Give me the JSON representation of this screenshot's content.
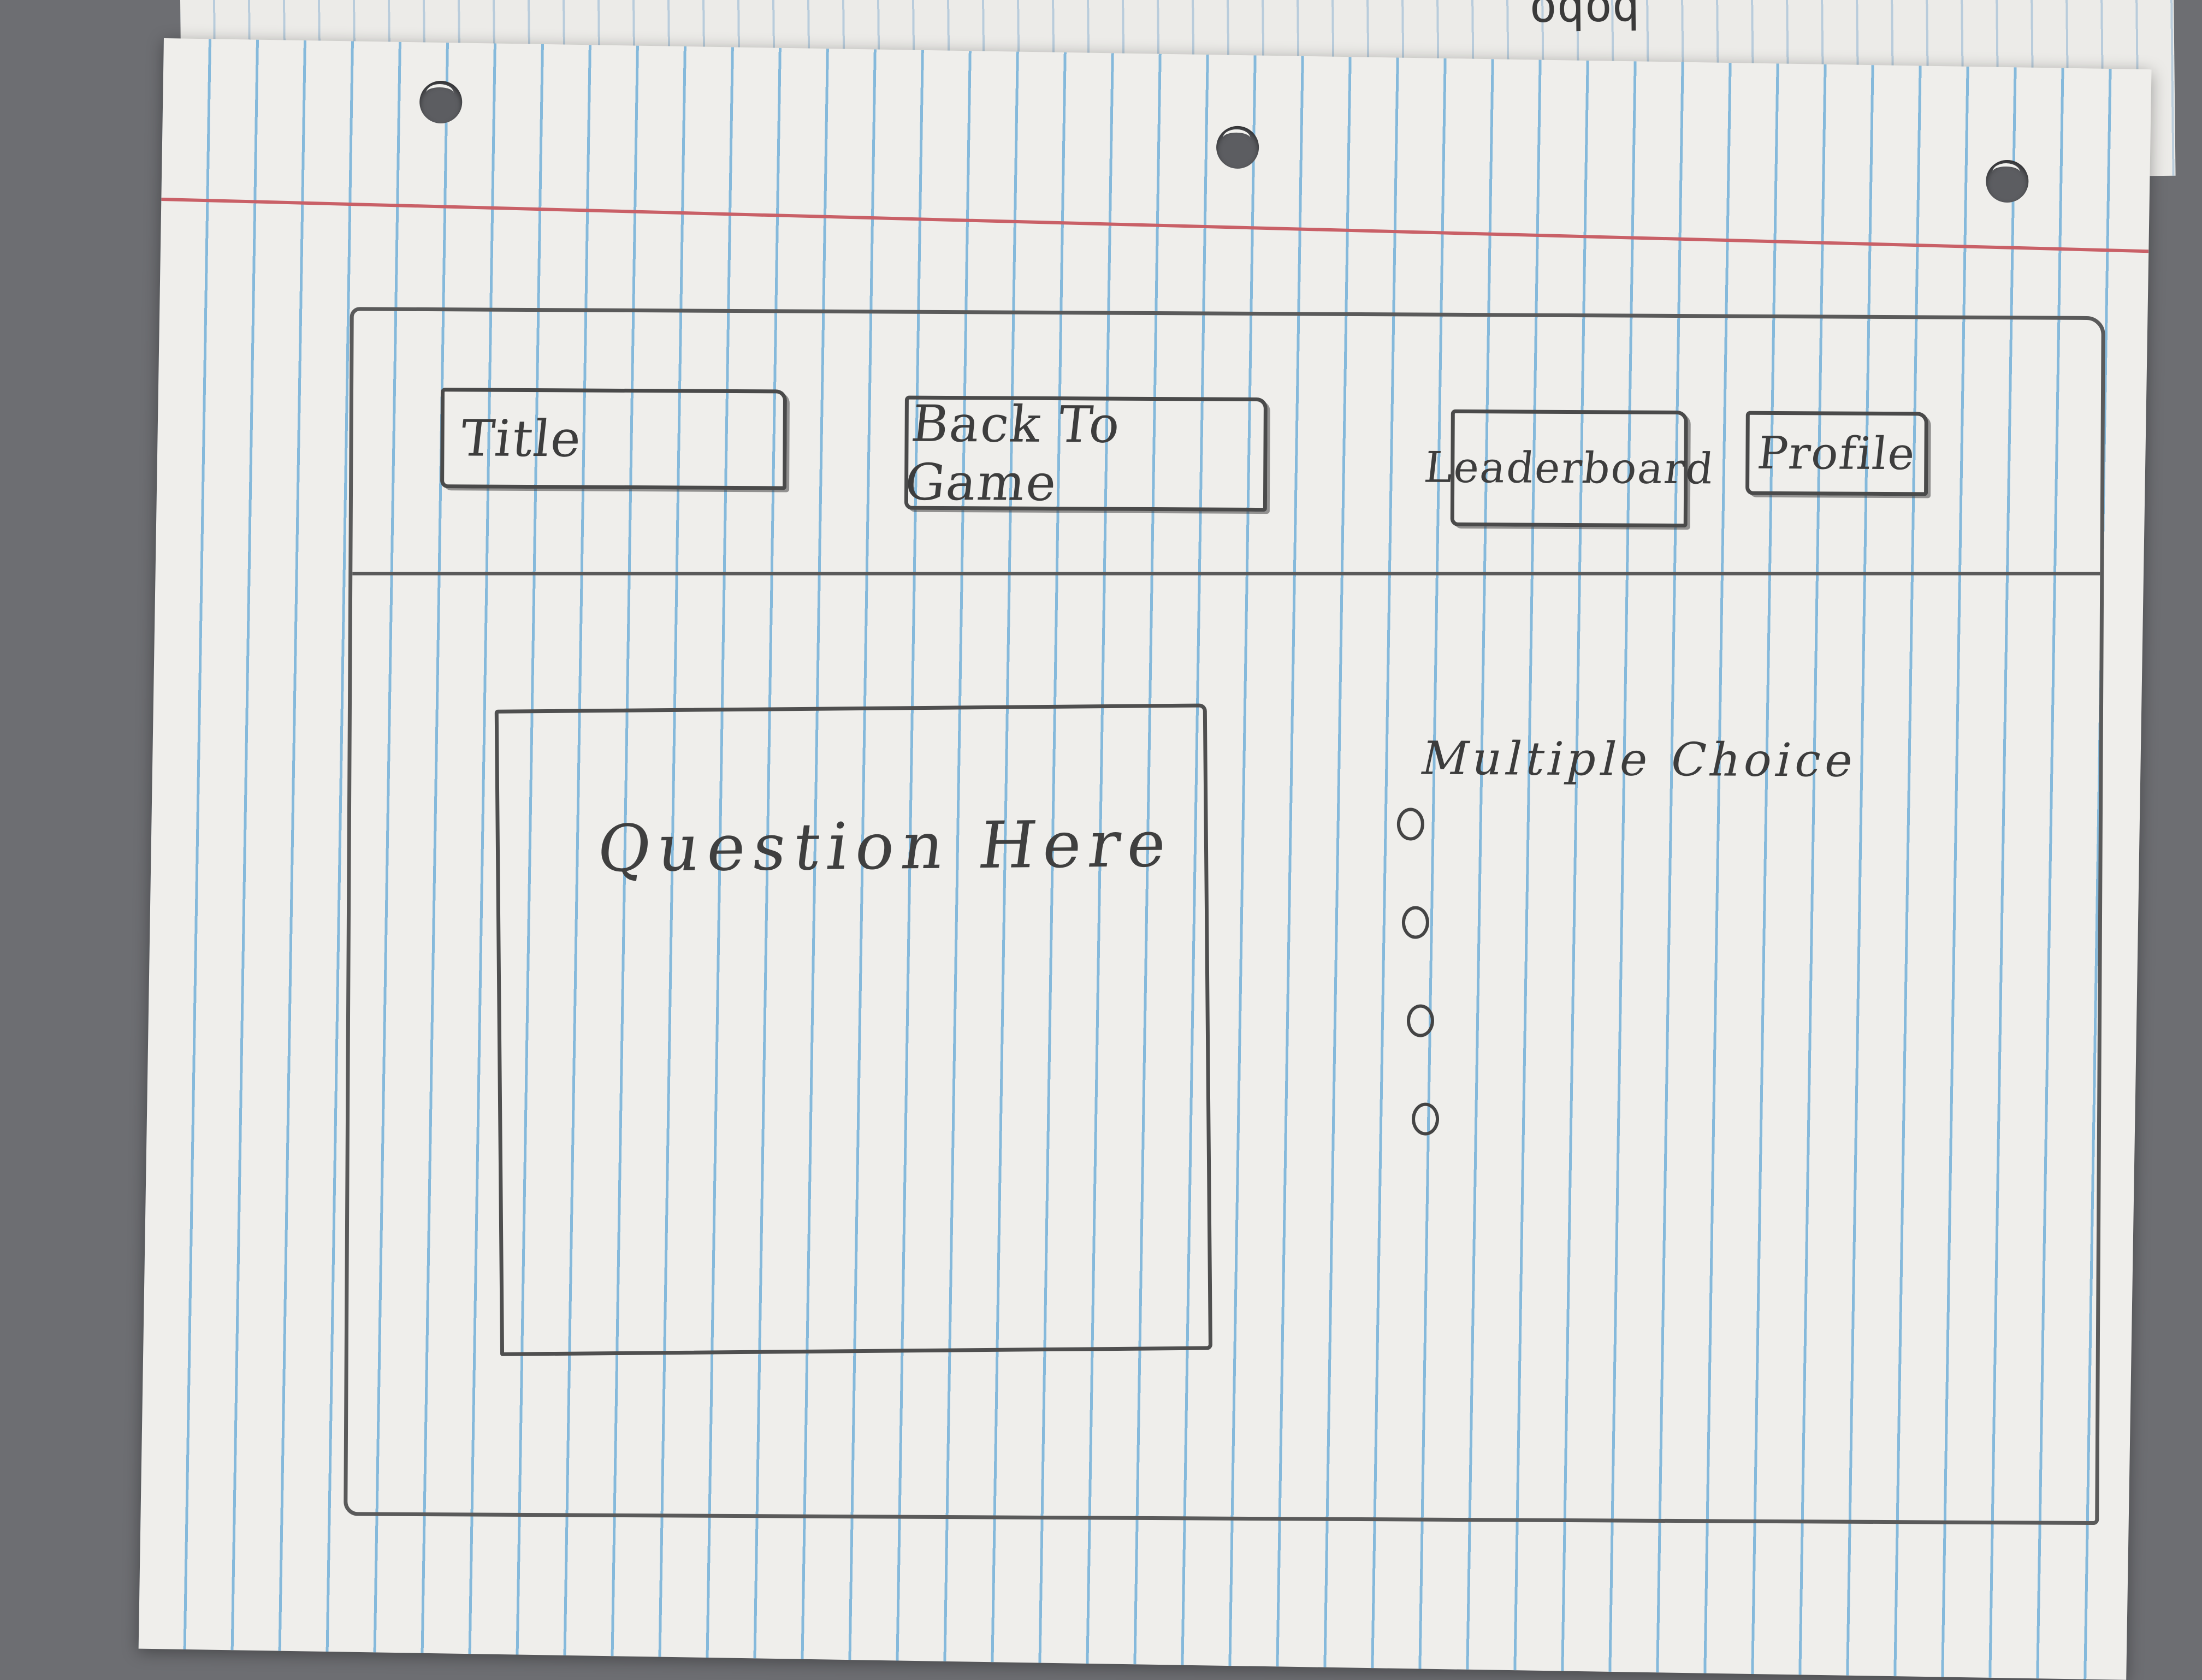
{
  "background_sheet": {
    "scribble_text": "odod"
  },
  "wireframe": {
    "header": {
      "title_label": "Title",
      "back_button_label": "Back To Game",
      "leaderboard_button_label": "Leaderboard",
      "profile_button_label": "Profile"
    },
    "main": {
      "question_placeholder": "Question Here",
      "multiple_choice_label": "Multiple Choice",
      "choices": [
        "",
        "",
        "",
        ""
      ]
    }
  },
  "colors": {
    "paper": "#efeeeb",
    "blue_rule": "#79b3d9",
    "red_margin": "#c96067",
    "pencil": "#4a4a4a",
    "desk": "#6d6e72"
  }
}
